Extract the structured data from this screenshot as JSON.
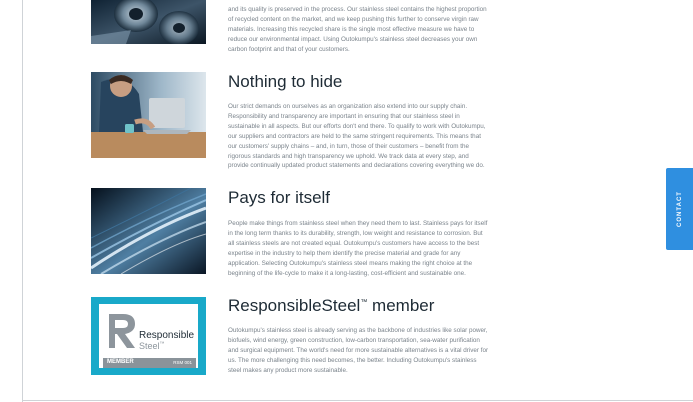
{
  "sections": [
    {
      "heading": "",
      "body": "and its quality is preserved in the process. Our stainless steel contains the highest proportion of recycled content on the market, and we keep pushing this further to conserve virgin raw materials. Increasing this recycled share is the single most effective measure we have to reduce our environmental impact. Using Outokumpu's stainless steel decreases your own carbon footprint and that of your customers.",
      "image": "steel-coils-image"
    },
    {
      "heading": "Nothing to hide",
      "body": "Our strict demands on ourselves as an organization also extend into our supply chain. Responsibility and transparency are important in ensuring that our stainless steel in sustainable in all aspects. But our efforts don't end there. To qualify to work with Outokumpu, our suppliers and contractors are held to the same stringent requirements. This means that our customers' supply chains – and, in turn, those of their customers – benefit from the rigorous standards and high transparency we uphold. We track data at every step, and provide continually updated product statements and declarations covering everything we do.",
      "image": "person-at-laptop-image"
    },
    {
      "heading": "Pays for itself",
      "body": "People make things from stainless steel when they need them to last. Stainless pays for itself in the long term thanks to its durability, strength, low weight and resistance to corrosion. But all stainless steels are not created equal. Outokumpu's customers have access to the best expertise in the industry to help them identify the precise material and grade for any application. Selecting Outokumpu's stainless steel means making the right choice at the beginning of the life-cycle to make it a long-lasting, cost-efficient and sustainable one.",
      "image": "motion-light-streaks-image"
    },
    {
      "heading": "ResponsibleSteel",
      "heading_mark": "™",
      "heading_suffix": " member",
      "body": "Outokumpu's stainless steel is already serving as the backbone of industries like solar power, biofuels, wind energy, green construction, low-carbon transportation, sea-water purification and surgical equipment. The world's need for more sustainable alternatives is a vital driver for us. The more challenging this need becomes, the better. Including Outokumpu's stainless steel makes any product more sustainable.",
      "image": "responsiblesteel-badge"
    }
  ],
  "badge": {
    "word1": "Responsible",
    "word2": "Steel",
    "word2_mark": "™",
    "member": "MEMBER",
    "code": "RSM 001",
    "accent_color": "#19a9c9"
  },
  "contact_tab": {
    "label": "CONTACT",
    "color": "#2f8fe0"
  }
}
